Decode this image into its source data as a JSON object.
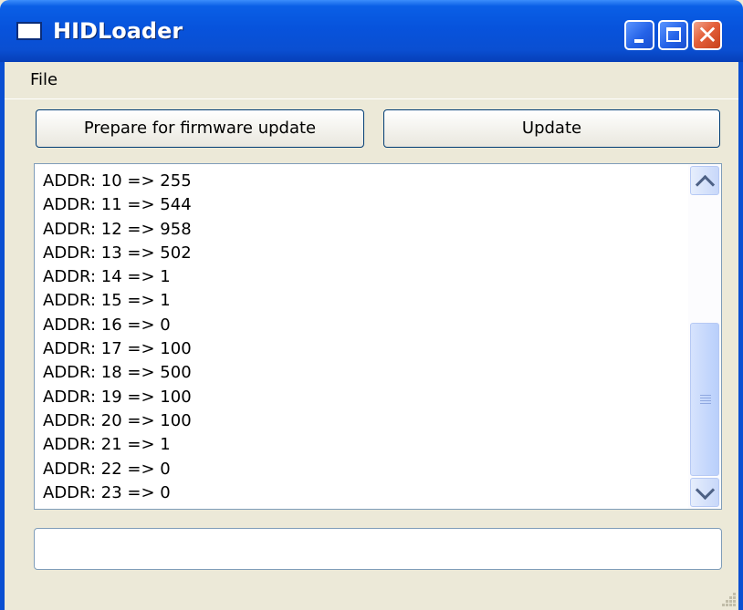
{
  "window": {
    "title": "HIDLoader"
  },
  "menubar": {
    "file_label": "File"
  },
  "buttons": {
    "prepare_label": "Prepare for firmware update",
    "update_label": "Update"
  },
  "log": {
    "items": [
      "ADDR: 10 => 255",
      "ADDR: 11 => 544",
      "ADDR: 12 => 958",
      "ADDR: 13 => 502",
      "ADDR: 14 => 1",
      "ADDR: 15 => 1",
      "ADDR: 16 => 0",
      "ADDR: 17 => 100",
      "ADDR: 18 => 500",
      "ADDR: 19 => 100",
      "ADDR: 20 => 100",
      "ADDR: 21 => 1",
      "ADDR: 22 => 0",
      "ADDR: 23 => 0"
    ],
    "scroll_position": 1.0
  },
  "status_field": {
    "value": ""
  },
  "icons": {
    "app": "app-window-icon",
    "minimize": "minimize-icon",
    "maximize": "maximize-icon",
    "close": "close-icon",
    "scroll_up": "chevron-up-icon",
    "scroll_down": "chevron-down-icon"
  },
  "colors": {
    "titlebar": "#0a5fe6",
    "close_button": "#e4603a",
    "window_bg": "#ece9d8",
    "scroll_thumb": "#c8d8fa"
  }
}
